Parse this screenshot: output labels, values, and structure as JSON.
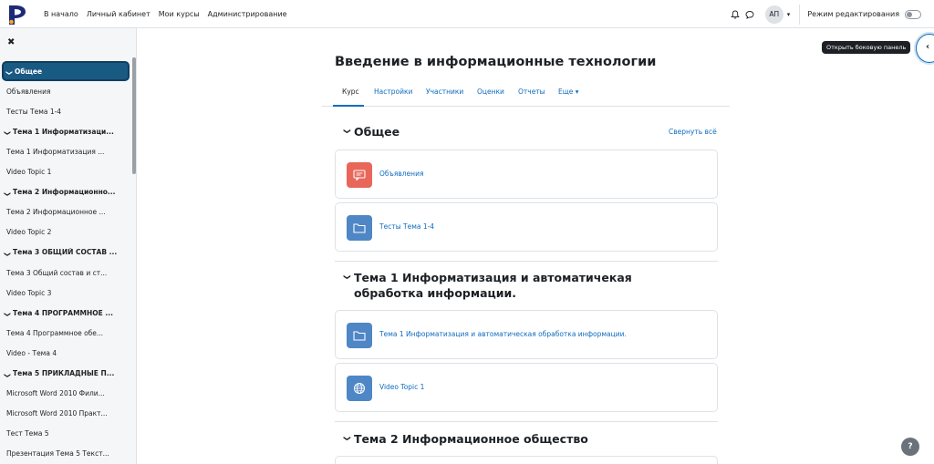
{
  "navbar": {
    "links": [
      "В начало",
      "Личный кабинет",
      "Мои курсы",
      "Администрирование"
    ],
    "avatar_initials": "АП",
    "edit_mode_label": "Режим редактирования"
  },
  "sidebar": {
    "items": [
      {
        "label": "Общее",
        "type": "section",
        "active": true
      },
      {
        "label": "Объявления",
        "type": "activity"
      },
      {
        "label": "Тесты Тема 1-4",
        "type": "activity"
      },
      {
        "label": "Тема 1 Информатизаци...",
        "type": "section"
      },
      {
        "label": "Тема 1 Информатизация ...",
        "type": "activity"
      },
      {
        "label": "Video Topic 1",
        "type": "activity"
      },
      {
        "label": "Тема 2 Информационно...",
        "type": "section"
      },
      {
        "label": "Тема 2 Информационное ...",
        "type": "activity"
      },
      {
        "label": "Video Topic 2",
        "type": "activity"
      },
      {
        "label": "Тема 3 ОБЩИЙ СОСТАВ ...",
        "type": "section"
      },
      {
        "label": "Тема 3 Общий состав и ст...",
        "type": "activity"
      },
      {
        "label": "Video Topic 3",
        "type": "activity"
      },
      {
        "label": "Тема 4 ПРОГРАММНОЕ ...",
        "type": "section"
      },
      {
        "label": "Тема 4 Программное обе...",
        "type": "activity"
      },
      {
        "label": "Video - Тема 4",
        "type": "activity"
      },
      {
        "label": "Тема 5 ПРИКЛАДНЫЕ П...",
        "type": "section"
      },
      {
        "label": "Microsoft Word 2010 Фили...",
        "type": "activity"
      },
      {
        "label": "Microsoft Word 2010 Практ...",
        "type": "activity"
      },
      {
        "label": "Тест Тема 5",
        "type": "activity"
      },
      {
        "label": "Презентация Тема 5 Текст...",
        "type": "activity"
      }
    ]
  },
  "drawer_tooltip": "Открыть боковую панель",
  "course": {
    "title": "Введение в информационные технологии",
    "tabs": [
      "Курс",
      "Настройки",
      "Участники",
      "Оценки",
      "Отчеты",
      "Еще"
    ],
    "collapse_all": "Свернуть всё",
    "sections": [
      {
        "title": "Общее",
        "activities": [
          {
            "name": "Объявления",
            "icon": "forum-icon",
            "color": "#e85d4c"
          },
          {
            "name": "Тесты Тема 1-4",
            "icon": "folder-icon",
            "color": "#4f86c6"
          }
        ]
      },
      {
        "title": "Тема 1 Информатизация и автоматичекая обработка информации.",
        "activities": [
          {
            "name": "Тема 1 Информатизация и автоматическая обработка информации.",
            "icon": "folder-icon",
            "color": "#4f86c6"
          },
          {
            "name": "Video Topic 1",
            "icon": "globe-icon",
            "color": "#4f86c6"
          }
        ]
      },
      {
        "title": "Тема 2 Информационное общество",
        "activities": []
      }
    ]
  },
  "help_label": "?"
}
